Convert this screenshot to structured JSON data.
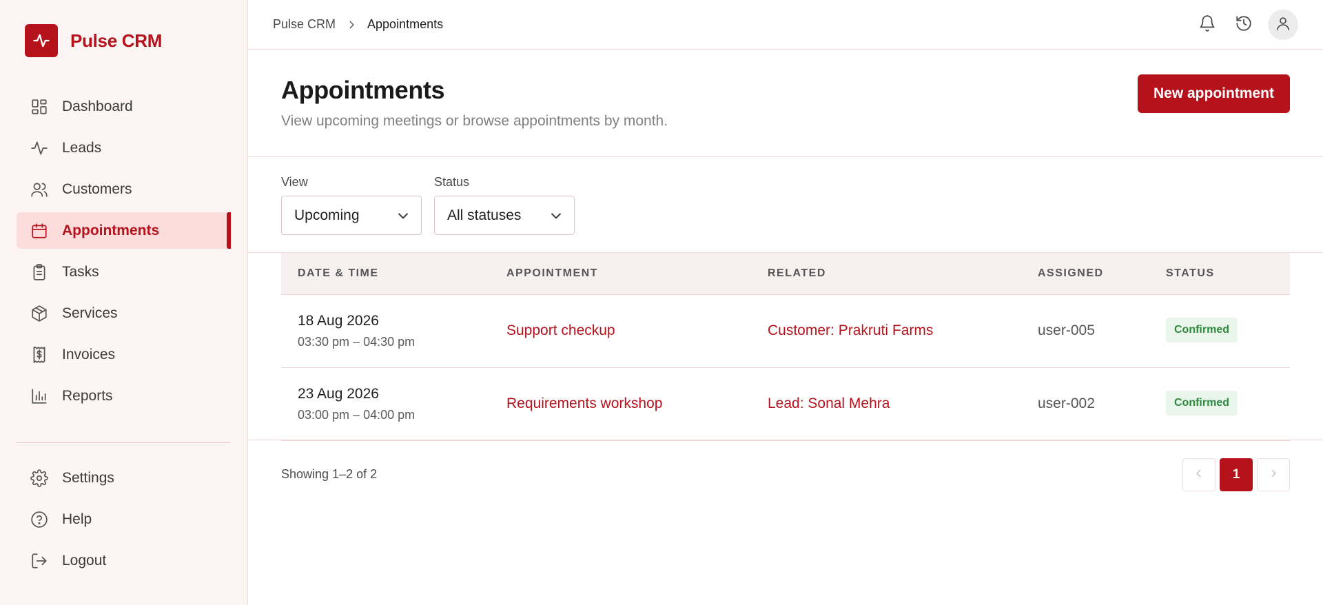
{
  "app": {
    "name": "Pulse CRM",
    "brand_color": "#b5121b"
  },
  "sidebar": {
    "items": [
      {
        "label": "Dashboard",
        "icon": "dashboard-icon"
      },
      {
        "label": "Leads",
        "icon": "activity-icon"
      },
      {
        "label": "Customers",
        "icon": "users-icon"
      },
      {
        "label": "Appointments",
        "icon": "calendar-icon",
        "active": true
      },
      {
        "label": "Tasks",
        "icon": "clipboard-icon"
      },
      {
        "label": "Services",
        "icon": "box-icon"
      },
      {
        "label": "Invoices",
        "icon": "receipt-icon"
      },
      {
        "label": "Reports",
        "icon": "bar-chart-icon"
      }
    ],
    "bottom_items": [
      {
        "label": "Settings",
        "icon": "gear-icon"
      },
      {
        "label": "Help",
        "icon": "help-icon"
      },
      {
        "label": "Logout",
        "icon": "logout-icon"
      }
    ]
  },
  "topbar": {
    "breadcrumb": {
      "root": "Pulse CRM",
      "current": "Appointments"
    }
  },
  "page": {
    "title": "Appointments",
    "subtitle": "View upcoming meetings or browse appointments by month.",
    "new_button": "New appointment"
  },
  "filters": {
    "view": {
      "label": "View",
      "value": "Upcoming"
    },
    "status": {
      "label": "Status",
      "value": "All statuses"
    }
  },
  "table": {
    "columns": [
      "DATE & TIME",
      "APPOINTMENT",
      "RELATED",
      "ASSIGNED",
      "STATUS"
    ],
    "rows": [
      {
        "date": "18 Aug 2026",
        "time": "03:30 pm – 04:30 pm",
        "appointment": "Support checkup",
        "related": "Customer: Prakruti Farms",
        "assigned": "user-005",
        "status": "Confirmed"
      },
      {
        "date": "23 Aug 2026",
        "time": "03:00 pm – 04:00 pm",
        "appointment": "Requirements workshop",
        "related": "Lead: Sonal Mehra",
        "assigned": "user-002",
        "status": "Confirmed"
      }
    ]
  },
  "pagination": {
    "showing": "Showing 1–2 of 2",
    "current_page": "1"
  }
}
